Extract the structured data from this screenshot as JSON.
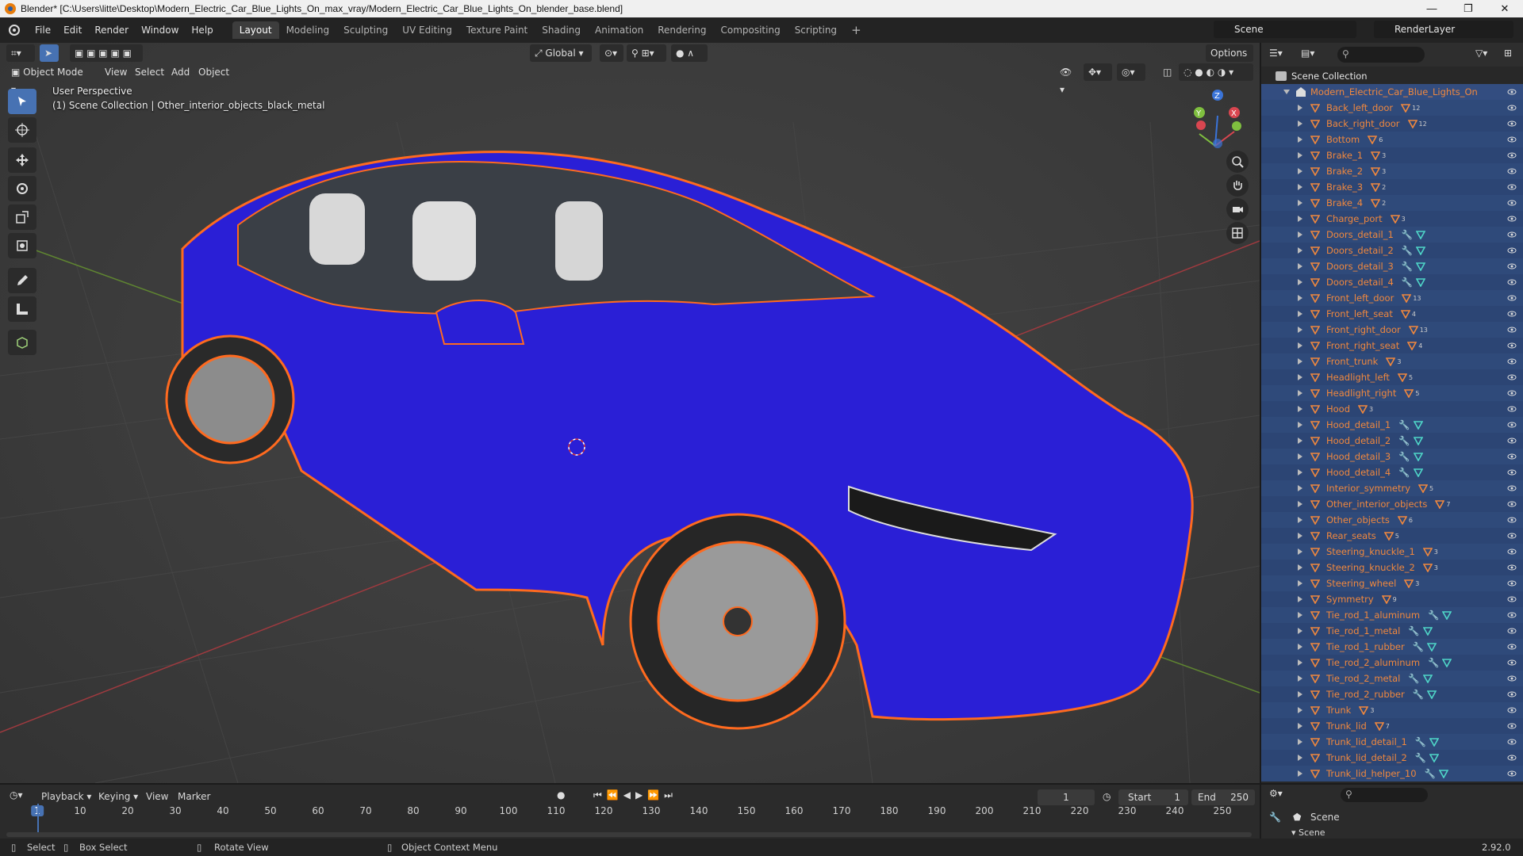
{
  "window": {
    "title": "Blender* [C:\\Users\\litte\\Desktop\\Modern_Electric_Car_Blue_Lights_On_max_vray/Modern_Electric_Car_Blue_Lights_On_blender_base.blend]",
    "minimize": "—",
    "maximize": "❐",
    "close": "✕"
  },
  "menus": [
    "File",
    "Edit",
    "Render",
    "Window",
    "Help"
  ],
  "workspaces": [
    "Layout",
    "Modeling",
    "Sculpting",
    "UV Editing",
    "Texture Paint",
    "Shading",
    "Animation",
    "Rendering",
    "Compositing",
    "Scripting"
  ],
  "scene": {
    "name": "Scene",
    "view_layer": "RenderLayer"
  },
  "viewport": {
    "mode": "Object Mode",
    "header_menus": [
      "View",
      "Select",
      "Add",
      "Object"
    ],
    "transform_orientation": "Global",
    "options": "Options",
    "overlay_title": "User Perspective",
    "overlay_subtitle": "(1) Scene Collection | Other_interior_objects_black_metal",
    "gizmo_axes": {
      "x": "X",
      "y": "Y",
      "z": "Z"
    },
    "colors": {
      "car_body": "#2a1fd6",
      "outline": "#ff6a1f",
      "grid": "#4a4a4a",
      "x_axis": "#c0393f",
      "y_axis": "#7aa33a"
    }
  },
  "outliner": {
    "search_placeholder": "",
    "root": "Scene Collection",
    "collection": "Modern_Electric_Car_Blue_Lights_On",
    "items": [
      {
        "name": "Back_left_door",
        "badge": "12"
      },
      {
        "name": "Back_right_door",
        "badge": "12"
      },
      {
        "name": "Bottom",
        "badge": "6"
      },
      {
        "name": "Brake_1",
        "badge": "3"
      },
      {
        "name": "Brake_2",
        "badge": "3"
      },
      {
        "name": "Brake_3",
        "badge": "2"
      },
      {
        "name": "Brake_4",
        "badge": "2"
      },
      {
        "name": "Charge_port",
        "badge": "3"
      },
      {
        "name": "Doors_detail_1",
        "badge": ""
      },
      {
        "name": "Doors_detail_2",
        "badge": ""
      },
      {
        "name": "Doors_detail_3",
        "badge": ""
      },
      {
        "name": "Doors_detail_4",
        "badge": ""
      },
      {
        "name": "Front_left_door",
        "badge": "13"
      },
      {
        "name": "Front_left_seat",
        "badge": "4"
      },
      {
        "name": "Front_right_door",
        "badge": "13"
      },
      {
        "name": "Front_right_seat",
        "badge": "4"
      },
      {
        "name": "Front_trunk",
        "badge": "3"
      },
      {
        "name": "Headlight_left",
        "badge": "5"
      },
      {
        "name": "Headlight_right",
        "badge": "5"
      },
      {
        "name": "Hood",
        "badge": "3"
      },
      {
        "name": "Hood_detail_1",
        "badge": ""
      },
      {
        "name": "Hood_detail_2",
        "badge": ""
      },
      {
        "name": "Hood_detail_3",
        "badge": ""
      },
      {
        "name": "Hood_detail_4",
        "badge": ""
      },
      {
        "name": "Interior_symmetry",
        "badge": "5"
      },
      {
        "name": "Other_interior_objects",
        "badge": "7"
      },
      {
        "name": "Other_objects",
        "badge": "6"
      },
      {
        "name": "Rear_seats",
        "badge": "5"
      },
      {
        "name": "Steering_knuckle_1",
        "badge": "3"
      },
      {
        "name": "Steering_knuckle_2",
        "badge": "3"
      },
      {
        "name": "Steering_wheel",
        "badge": "3"
      },
      {
        "name": "Symmetry",
        "badge": "9"
      },
      {
        "name": "Tie_rod_1_aluminum",
        "badge": ""
      },
      {
        "name": "Tie_rod_1_metal",
        "badge": ""
      },
      {
        "name": "Tie_rod_1_rubber",
        "badge": ""
      },
      {
        "name": "Tie_rod_2_aluminum",
        "badge": ""
      },
      {
        "name": "Tie_rod_2_metal",
        "badge": ""
      },
      {
        "name": "Tie_rod_2_rubber",
        "badge": ""
      },
      {
        "name": "Trunk",
        "badge": "3"
      },
      {
        "name": "Trunk_lid",
        "badge": "7"
      },
      {
        "name": "Trunk_lid_detail_1",
        "badge": ""
      },
      {
        "name": "Trunk_lid_detail_2",
        "badge": ""
      },
      {
        "name": "Trunk_lid_helper_10",
        "badge": ""
      }
    ]
  },
  "properties": {
    "scene_label": "Scene",
    "section": "Scene"
  },
  "timeline": {
    "menus": [
      "Playback",
      "Keying",
      "View",
      "Marker"
    ],
    "current_frame": "1",
    "start_label": "Start",
    "start": "1",
    "end_label": "End",
    "end": "250",
    "ticks": [
      "1",
      "10",
      "20",
      "30",
      "40",
      "50",
      "60",
      "70",
      "80",
      "90",
      "100",
      "110",
      "120",
      "130",
      "140",
      "150",
      "160",
      "170",
      "180",
      "190",
      "200",
      "210",
      "220",
      "230",
      "240",
      "250"
    ]
  },
  "status": {
    "select": "Select",
    "box_select": "Box Select",
    "rotate_view": "Rotate View",
    "context_menu": "Object Context Menu",
    "version": "2.92.0"
  }
}
